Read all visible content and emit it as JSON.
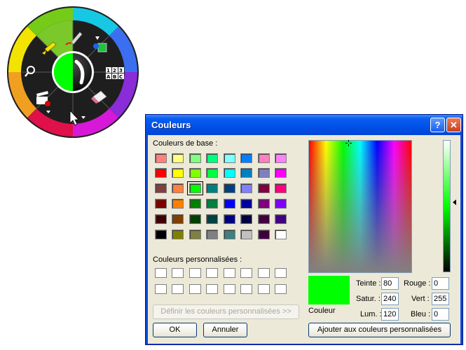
{
  "radial_menu": {
    "hub_color": "#00ff00",
    "ring_colors": [
      "#00c8e0",
      "#3a7df2",
      "#7a30d8",
      "#d818e0",
      "#e0104a",
      "#f0a020",
      "#f0e000",
      "#7ad018"
    ],
    "tools": [
      {
        "name": "highlighter",
        "icon": "highlighter-icon"
      },
      {
        "name": "pen",
        "icon": "pen-icon"
      },
      {
        "name": "shapes",
        "icon": "shapes-icon"
      },
      {
        "name": "text",
        "icon": "text-abc-icon"
      },
      {
        "name": "eraser",
        "icon": "eraser-icon"
      },
      {
        "name": "select",
        "icon": "cursor-icon"
      },
      {
        "name": "record",
        "icon": "clapper-record-icon"
      },
      {
        "name": "zoom",
        "icon": "magnifier-icon"
      }
    ]
  },
  "dialog": {
    "title": "Couleurs",
    "help_label": "?",
    "close_label": "✕",
    "basic_colors_label": "Couleurs de base :",
    "custom_colors_label": "Couleurs personnalisées :",
    "define_custom_label": "Définir les couleurs personnalisées >>",
    "ok_label": "OK",
    "cancel_label": "Annuler",
    "add_custom_label": "Ajouter aux couleurs personnalisées",
    "color_caption": "Couleur",
    "basic_colors": [
      [
        "#ff8080",
        "#ffff80",
        "#80ff80",
        "#00ff80",
        "#80ffff",
        "#0080ff",
        "#ff80c0",
        "#ff80ff"
      ],
      [
        "#ff0000",
        "#ffff00",
        "#80ff00",
        "#00ff40",
        "#00ffff",
        "#0080c0",
        "#8080c0",
        "#ff00ff"
      ],
      [
        "#804040",
        "#ff8040",
        "#00ff00",
        "#008080",
        "#004080",
        "#8080ff",
        "#800040",
        "#ff0080"
      ],
      [
        "#800000",
        "#ff8000",
        "#008000",
        "#008040",
        "#0000ff",
        "#0000a0",
        "#800080",
        "#8000ff"
      ],
      [
        "#400000",
        "#804000",
        "#004000",
        "#004040",
        "#000080",
        "#000040",
        "#400040",
        "#400080"
      ],
      [
        "#000000",
        "#808000",
        "#808040",
        "#808080",
        "#408080",
        "#c0c0c0",
        "#400040",
        "#ffffff"
      ]
    ],
    "selected_basic": [
      2,
      2
    ],
    "custom_colors": [
      [
        "#ffffff",
        "#ffffff",
        "#ffffff",
        "#ffffff",
        "#ffffff",
        "#ffffff",
        "#ffffff",
        "#ffffff"
      ],
      [
        "#ffffff",
        "#ffffff",
        "#ffffff",
        "#ffffff",
        "#ffffff",
        "#ffffff",
        "#ffffff",
        "#ffffff"
      ]
    ],
    "fields": {
      "hue_label": "Teinte :",
      "hue": "80",
      "sat_label": "Satur. :",
      "sat": "240",
      "lum_label": "Lum. :",
      "lum": "120",
      "red_label": "Rouge :",
      "red": "0",
      "green_label": "Vert :",
      "green": "255",
      "blue_label": "Bleu :",
      "blue": "0"
    },
    "current_color": "#00ff00"
  }
}
